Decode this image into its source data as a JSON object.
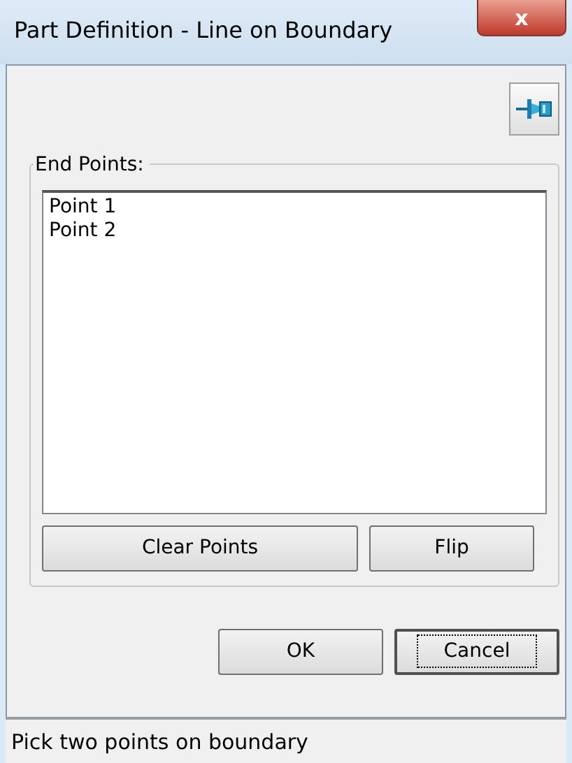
{
  "window": {
    "title": "Part Definition - Line on Boundary",
    "close": "x"
  },
  "end_points": {
    "label": "End Points:",
    "items": [
      {
        "text": "Point 1"
      },
      {
        "text": "Point 2"
      }
    ]
  },
  "point_buttons": [
    {
      "label": "Clear Points",
      "focused": false
    },
    {
      "label": "Flip",
      "focused": false
    }
  ],
  "dialog_buttons": [
    {
      "label": "OK",
      "focused": false
    },
    {
      "label": "Cancel",
      "focused": true
    }
  ],
  "status_bar": "Pick two points on boundary"
}
